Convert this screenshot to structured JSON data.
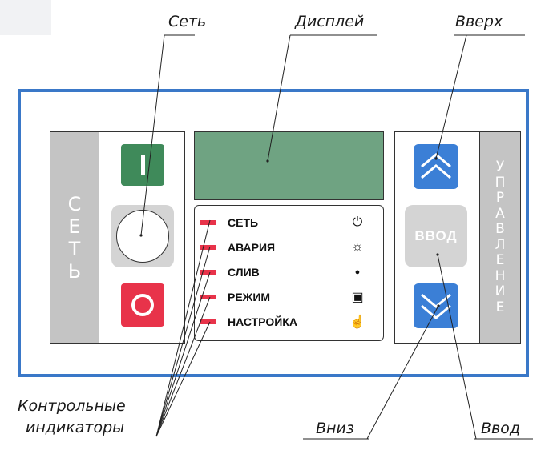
{
  "callouts": {
    "power": "Сеть",
    "display": "Дисплей",
    "up": "Вверх",
    "indicators_line1": "Контрольные",
    "indicators_line2": "индикаторы",
    "down": "Вниз",
    "enter": "Ввод"
  },
  "panel": {
    "left_side_label": [
      "С",
      "Е",
      "Т",
      "Ь"
    ],
    "right_side_label": [
      "У",
      "П",
      "Р",
      "А",
      "В",
      "Л",
      "Е",
      "Н",
      "И",
      "Е"
    ],
    "enter_button_label": "ВВОД"
  },
  "indicators": [
    {
      "label": "СЕТЬ",
      "icon": "power-icon",
      "glyph": "⏻"
    },
    {
      "label": "АВАРИЯ",
      "icon": "sun-gear-icon",
      "glyph": "☼"
    },
    {
      "label": "СЛИВ",
      "icon": "drop-icon",
      "glyph": "●"
    },
    {
      "label": "РЕЖИМ",
      "icon": "mode-icon",
      "glyph": "▣"
    },
    {
      "label": "НАСТРОЙКА",
      "icon": "hand-pointer-icon",
      "glyph": "☝"
    }
  ],
  "colors": {
    "frame": "#3a78c8",
    "on_button": "#3f8a5a",
    "off_button": "#e8334a",
    "display": "#6fa382",
    "nav_buttons": "#3b7fd6",
    "led": "#e8334a",
    "side_labels": "#c4c4c4"
  }
}
